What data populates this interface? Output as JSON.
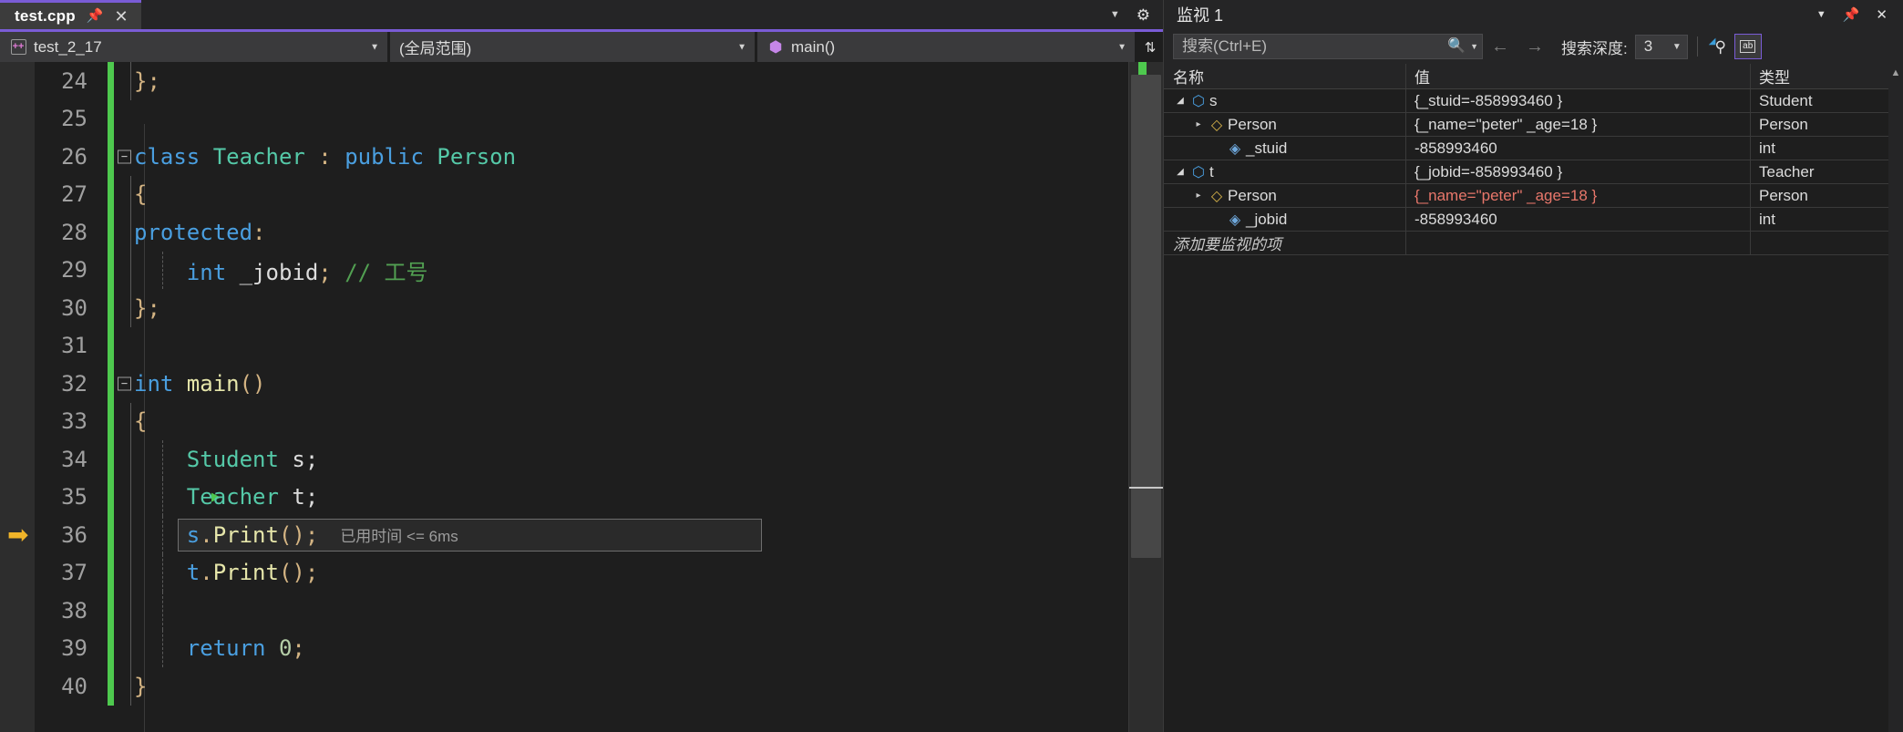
{
  "editor": {
    "tab": {
      "title": "test.cpp",
      "pin_icon": "pin-icon",
      "close_icon": "close-icon"
    },
    "tabstrip": {
      "dropdown_icon": "chevron-down-icon",
      "settings_icon": "gear-icon"
    },
    "navbar": {
      "project": "test_2_17",
      "scope": "(全局范围)",
      "member": "main()",
      "project_icon": "cpp-project-icon",
      "member_icon": "method-cube-icon",
      "split_icon": "split-window-icon"
    },
    "lines": [
      {
        "num": "24",
        "tokens": [
          {
            "t": "};",
            "c": "pun"
          }
        ],
        "fold": false,
        "indent": 1,
        "changed": true
      },
      {
        "num": "25",
        "tokens": [],
        "fold": false,
        "indent": 0,
        "changed": true
      },
      {
        "num": "26",
        "tokens": [
          {
            "t": "class ",
            "c": "kw"
          },
          {
            "t": "Teacher",
            "c": "typ"
          },
          {
            "t": " : ",
            "c": "pun"
          },
          {
            "t": "public ",
            "c": "kw"
          },
          {
            "t": "Person",
            "c": "typ"
          }
        ],
        "fold": true,
        "indent": 0,
        "changed": true
      },
      {
        "num": "27",
        "tokens": [
          {
            "t": "{",
            "c": "pun"
          }
        ],
        "fold": false,
        "indent": 1,
        "changed": true
      },
      {
        "num": "28",
        "tokens": [
          {
            "t": "protected",
            "c": "kw"
          },
          {
            "t": ":",
            "c": "pun"
          }
        ],
        "fold": false,
        "indent": 1,
        "changed": true
      },
      {
        "num": "29",
        "tokens": [
          {
            "t": "    ",
            "c": "plain"
          },
          {
            "t": "int ",
            "c": "kw"
          },
          {
            "t": "_jobid",
            "c": "var"
          },
          {
            "t": "; ",
            "c": "pun"
          },
          {
            "t": "// 工号",
            "c": "cmt"
          }
        ],
        "fold": false,
        "indent": 2,
        "changed": true
      },
      {
        "num": "30",
        "tokens": [
          {
            "t": "};",
            "c": "pun"
          }
        ],
        "fold": false,
        "indent": 1,
        "changed": true
      },
      {
        "num": "31",
        "tokens": [],
        "fold": false,
        "indent": 0,
        "changed": true
      },
      {
        "num": "32",
        "tokens": [
          {
            "t": "int ",
            "c": "kw"
          },
          {
            "t": "main",
            "c": "fn"
          },
          {
            "t": "()",
            "c": "pun"
          }
        ],
        "fold": true,
        "indent": 0,
        "changed": true
      },
      {
        "num": "33",
        "tokens": [
          {
            "t": "{",
            "c": "pun"
          }
        ],
        "fold": false,
        "indent": 1,
        "changed": true
      },
      {
        "num": "34",
        "tokens": [
          {
            "t": "    ",
            "c": "plain"
          },
          {
            "t": "Student",
            "c": "typ"
          },
          {
            "t": " s;",
            "c": "var"
          }
        ],
        "fold": false,
        "indent": 2,
        "changed": true
      },
      {
        "num": "35",
        "tokens": [
          {
            "t": "    ",
            "c": "plain"
          },
          {
            "t": "Teacher",
            "c": "typ"
          },
          {
            "t": " t;",
            "c": "var"
          }
        ],
        "fold": false,
        "indent": 2,
        "changed": true
      },
      {
        "num": "36",
        "tokens": [
          {
            "t": "    ",
            "c": "plain"
          },
          {
            "t": "s",
            "c": "kw"
          },
          {
            "t": ".",
            "c": "pun"
          },
          {
            "t": "Print",
            "c": "fn"
          },
          {
            "t": "();",
            "c": "pun"
          }
        ],
        "fold": false,
        "indent": 2,
        "changed": true,
        "current": true,
        "elapsed": "已用时间 <= 6ms"
      },
      {
        "num": "37",
        "tokens": [
          {
            "t": "    ",
            "c": "plain"
          },
          {
            "t": "t",
            "c": "kw"
          },
          {
            "t": ".",
            "c": "pun"
          },
          {
            "t": "Print",
            "c": "fn"
          },
          {
            "t": "();",
            "c": "pun"
          }
        ],
        "fold": false,
        "indent": 2,
        "changed": true
      },
      {
        "num": "38",
        "tokens": [],
        "fold": false,
        "indent": 2,
        "changed": true
      },
      {
        "num": "39",
        "tokens": [
          {
            "t": "    ",
            "c": "plain"
          },
          {
            "t": "return ",
            "c": "kw"
          },
          {
            "t": "0",
            "c": "num"
          },
          {
            "t": ";",
            "c": "pun"
          }
        ],
        "fold": false,
        "indent": 2,
        "changed": true
      },
      {
        "num": "40",
        "tokens": [
          {
            "t": "}",
            "c": "pun"
          }
        ],
        "fold": false,
        "indent": 1,
        "changed": true
      }
    ],
    "exec_arrow_icon": "execution-pointer-icon",
    "step_into_icon": "step-into-specific-icon"
  },
  "watch": {
    "title": "监视 1",
    "titlebar": {
      "dropdown_icon": "chevron-down-icon",
      "pin_icon": "pin-icon",
      "close_icon": "close-icon"
    },
    "search": {
      "placeholder": "搜索(Ctrl+E)",
      "value": "",
      "icon": "search-icon",
      "options_icon": "chevron-down-icon"
    },
    "nav": {
      "back_icon": "arrow-left-icon",
      "forward_icon": "arrow-right-icon"
    },
    "depth": {
      "label": "搜索深度:",
      "value": "3",
      "caret_icon": "chevron-down-icon"
    },
    "toggles": [
      {
        "name": "pin-column-toggle",
        "icon": "pin-filter-icon",
        "active": false
      },
      {
        "name": "hex-display-toggle",
        "icon": "ab-format-icon",
        "active": true
      }
    ],
    "columns": {
      "name": "名称",
      "value": "值",
      "type": "类型"
    },
    "rows": [
      {
        "name": "s",
        "value": "{_stuid=-858993460 }",
        "type": "Student",
        "depth": 0,
        "expander": "open",
        "icon": "struct-icon",
        "changed": false
      },
      {
        "name": "Person",
        "value": "{_name=\"peter\" _age=18 }",
        "type": "Person",
        "depth": 1,
        "expander": "closed",
        "icon": "base-class-icon",
        "changed": false
      },
      {
        "name": "_stuid",
        "value": "-858993460",
        "type": "int",
        "depth": 2,
        "expander": "none",
        "icon": "field-icon",
        "changed": false
      },
      {
        "name": "t",
        "value": "{_jobid=-858993460 }",
        "type": "Teacher",
        "depth": 0,
        "expander": "open",
        "icon": "struct-icon",
        "changed": false
      },
      {
        "name": "Person",
        "value": "{_name=\"peter\" _age=18 }",
        "type": "Person",
        "depth": 1,
        "expander": "closed",
        "icon": "base-class-icon",
        "changed": true
      },
      {
        "name": "_jobid",
        "value": "-858993460",
        "type": "int",
        "depth": 2,
        "expander": "none",
        "icon": "field-icon",
        "changed": false
      }
    ],
    "add_row_placeholder": "添加要监视的项",
    "scroll_up_icon": "scroll-up-icon"
  },
  "colors": {
    "accent_purple": "#7a5cd6",
    "change_green": "#4ec94e",
    "exec_yellow": "#f0b429",
    "changed_value": "#e8776b",
    "editor_bg": "#1e1e1e"
  }
}
